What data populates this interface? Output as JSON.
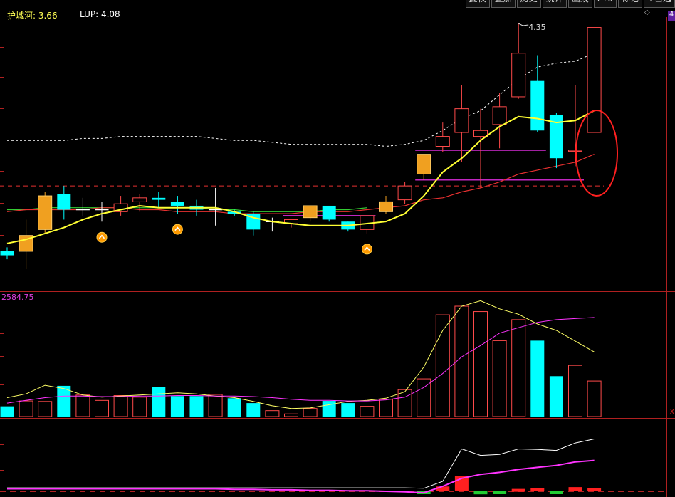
{
  "toolbar": {
    "buttons": [
      "复权",
      "叠加",
      "历史",
      "统计",
      "画线",
      "F10",
      "标记",
      "+自选"
    ]
  },
  "indicator": {
    "label_name": "护城河: 3.66",
    "lup": "LUP: 4.08"
  },
  "annotation": {
    "high_label": "4.35"
  },
  "volume": {
    "label": "2584.75"
  },
  "corner": {
    "scroll_marker": "◇",
    "badge": "4",
    "close": "X"
  },
  "colors": {
    "background": "#000000",
    "up": "#ff4a4a",
    "down": "#00ffff",
    "gold": "#f0a020",
    "ma_yellow": "#ffff33",
    "ma_red": "#e63030",
    "ma_green": "#33cc33",
    "ma_magenta": "#ff33ff",
    "support_line": "#ff33ff",
    "grid": "#b02020",
    "circle": "#ff2020"
  },
  "chart_data": [
    {
      "type": "candlestick",
      "candles": [
        {
          "o": 3.18,
          "h": 3.22,
          "l": 3.16,
          "c": 3.2,
          "s": "down"
        },
        {
          "o": 3.2,
          "h": 3.36,
          "l": 3.11,
          "c": 3.28,
          "s": "gold"
        },
        {
          "o": 3.31,
          "h": 3.5,
          "l": 3.29,
          "c": 3.48,
          "s": "gold"
        },
        {
          "o": 3.49,
          "h": 3.53,
          "l": 3.36,
          "c": 3.41,
          "s": "down"
        },
        {
          "o": 3.41,
          "h": 3.47,
          "l": 3.38,
          "c": 3.41,
          "s": "flat"
        },
        {
          "o": 3.41,
          "h": 3.45,
          "l": 3.35,
          "c": 3.41,
          "s": "flat"
        },
        {
          "o": 3.4,
          "h": 3.48,
          "l": 3.38,
          "c": 3.44,
          "s": "up"
        },
        {
          "o": 3.45,
          "h": 3.49,
          "l": 3.4,
          "c": 3.47,
          "s": "up"
        },
        {
          "o": 3.47,
          "h": 3.5,
          "l": 3.42,
          "c": 3.46,
          "s": "down"
        },
        {
          "o": 3.45,
          "h": 3.48,
          "l": 3.39,
          "c": 3.43,
          "s": "down"
        },
        {
          "o": 3.43,
          "h": 3.46,
          "l": 3.38,
          "c": 3.41,
          "s": "down"
        },
        {
          "o": 3.41,
          "h": 3.52,
          "l": 3.33,
          "c": 3.41,
          "s": "flat"
        },
        {
          "o": 3.4,
          "h": 3.41,
          "l": 3.38,
          "c": 3.39,
          "s": "down"
        },
        {
          "o": 3.39,
          "h": 3.4,
          "l": 3.28,
          "c": 3.31,
          "s": "down"
        },
        {
          "o": 3.35,
          "h": 3.37,
          "l": 3.3,
          "c": 3.35,
          "s": "flat"
        },
        {
          "o": 3.34,
          "h": 3.36,
          "l": 3.32,
          "c": 3.36,
          "s": "up"
        },
        {
          "o": 3.37,
          "h": 3.43,
          "l": 3.35,
          "c": 3.43,
          "s": "gold"
        },
        {
          "o": 3.43,
          "h": 3.43,
          "l": 3.35,
          "c": 3.36,
          "s": "down"
        },
        {
          "o": 3.35,
          "h": 3.35,
          "l": 3.3,
          "c": 3.31,
          "s": "down"
        },
        {
          "o": 3.31,
          "h": 3.38,
          "l": 3.29,
          "c": 3.38,
          "s": "up"
        },
        {
          "o": 3.4,
          "h": 3.48,
          "l": 3.39,
          "c": 3.45,
          "s": "gold"
        },
        {
          "o": 3.46,
          "h": 3.55,
          "l": 3.44,
          "c": 3.53,
          "s": "up"
        },
        {
          "o": 3.59,
          "h": 3.67,
          "l": 3.56,
          "c": 3.69,
          "s": "gold"
        },
        {
          "o": 3.73,
          "h": 3.85,
          "l": 3.7,
          "c": 3.78,
          "s": "up"
        },
        {
          "o": 3.8,
          "h": 4.04,
          "l": 3.65,
          "c": 3.92,
          "s": "up"
        },
        {
          "o": 3.78,
          "h": 3.92,
          "l": 3.52,
          "c": 3.81,
          "s": "up"
        },
        {
          "o": 3.84,
          "h": 4.0,
          "l": 3.72,
          "c": 3.93,
          "s": "up"
        },
        {
          "o": 3.98,
          "h": 4.35,
          "l": 3.97,
          "c": 4.2,
          "s": "up"
        },
        {
          "o": 4.06,
          "h": 4.19,
          "l": 3.8,
          "c": 3.81,
          "s": "down"
        },
        {
          "o": 3.89,
          "h": 3.9,
          "l": 3.62,
          "c": 3.67,
          "s": "down"
        },
        {
          "o": 3.71,
          "h": 4.04,
          "l": 3.63,
          "c": 3.71,
          "s": "up"
        },
        {
          "o": 3.8,
          "h": 4.33,
          "l": 3.8,
          "c": 4.33,
          "s": "up"
        }
      ],
      "ma_yellow": [
        3.24,
        3.26,
        3.29,
        3.32,
        3.36,
        3.39,
        3.41,
        3.43,
        3.42,
        3.42,
        3.42,
        3.42,
        3.4,
        3.37,
        3.35,
        3.34,
        3.33,
        3.33,
        3.33,
        3.34,
        3.35,
        3.39,
        3.48,
        3.6,
        3.67,
        3.76,
        3.83,
        3.88,
        3.87,
        3.85,
        3.86,
        3.91
      ],
      "ma_dash": [
        3.76,
        3.76,
        3.76,
        3.76,
        3.77,
        3.77,
        3.78,
        3.78,
        3.78,
        3.78,
        3.78,
        3.77,
        3.76,
        3.76,
        3.75,
        3.74,
        3.74,
        3.74,
        3.74,
        3.74,
        3.73,
        3.74,
        3.76,
        3.81,
        3.87,
        3.91,
        3.99,
        4.07,
        4.13,
        4.15,
        4.16,
        4.2
      ],
      "ma_red": [
        3.4,
        3.41,
        3.41,
        3.41,
        3.41,
        3.42,
        3.42,
        3.41,
        3.41,
        3.4,
        3.4,
        3.4,
        3.39,
        3.39,
        3.39,
        3.39,
        3.4,
        3.4,
        3.4,
        3.41,
        3.42,
        3.43,
        3.46,
        3.47,
        3.5,
        3.52,
        3.55,
        3.59,
        3.61,
        3.63,
        3.65,
        3.69
      ],
      "ma_green": [
        3.41,
        3.41,
        3.42,
        3.42,
        3.42,
        3.42,
        3.42,
        3.42,
        3.42,
        3.42,
        3.42,
        3.41,
        3.41,
        3.4,
        3.4,
        3.4,
        3.4,
        3.41,
        3.41,
        3.42
      ],
      "support_levels": [
        {
          "value": 3.71,
          "from": 22,
          "to": 28
        },
        {
          "value": 3.56,
          "from": 22,
          "to": 30
        },
        {
          "value": 3.38,
          "from": 15,
          "to": 19
        }
      ],
      "dashed_level": 3.53,
      "signal_markers": [
        5,
        9,
        19
      ]
    },
    {
      "type": "bar",
      "series_volume": [
        19,
        29,
        28,
        57,
        40,
        30,
        39,
        36,
        55,
        38,
        38,
        41,
        34,
        25,
        11,
        5,
        15,
        29,
        25,
        19,
        32,
        50,
        70,
        189,
        205,
        195,
        141,
        180,
        141,
        75,
        95,
        66
      ],
      "vol_ma_fast": [
        35,
        42,
        58,
        52,
        40,
        36,
        38,
        40,
        42,
        44,
        42,
        38,
        35,
        28,
        20,
        15,
        16,
        22,
        28,
        30,
        34,
        46,
        92,
        160,
        205,
        215,
        200,
        190,
        172,
        160,
        140,
        120
      ],
      "vol_ma_slow": [
        25,
        30,
        35,
        38,
        38,
        37,
        37,
        38,
        38,
        39,
        39,
        38,
        38,
        37,
        35,
        32,
        30,
        30,
        29,
        29,
        31,
        36,
        54,
        80,
        111,
        132,
        155,
        165,
        175,
        180,
        182,
        184
      ]
    },
    {
      "type": "line",
      "white": [
        7,
        7,
        7,
        7,
        7,
        7,
        7,
        7,
        7,
        7,
        7,
        7,
        7,
        7,
        7,
        7,
        7,
        7,
        7,
        7,
        7,
        7,
        6,
        20,
        85,
        72,
        74,
        85,
        84,
        82,
        97,
        105
      ],
      "magenta": [
        5,
        5,
        5,
        5,
        5,
        5,
        5,
        5,
        5,
        5,
        5,
        5,
        4,
        4,
        3,
        3,
        2,
        2,
        1,
        1,
        0,
        -1,
        -3,
        10,
        26,
        34,
        38,
        44,
        48,
        52,
        59,
        62
      ],
      "bars": [
        0,
        0,
        0,
        0,
        0,
        0,
        0,
        0,
        0,
        0,
        0,
        0,
        0,
        0,
        0,
        0,
        0,
        0,
        0,
        0,
        0,
        0,
        -3,
        8,
        25,
        -5,
        -4,
        4,
        5,
        -3,
        7,
        5
      ]
    }
  ]
}
